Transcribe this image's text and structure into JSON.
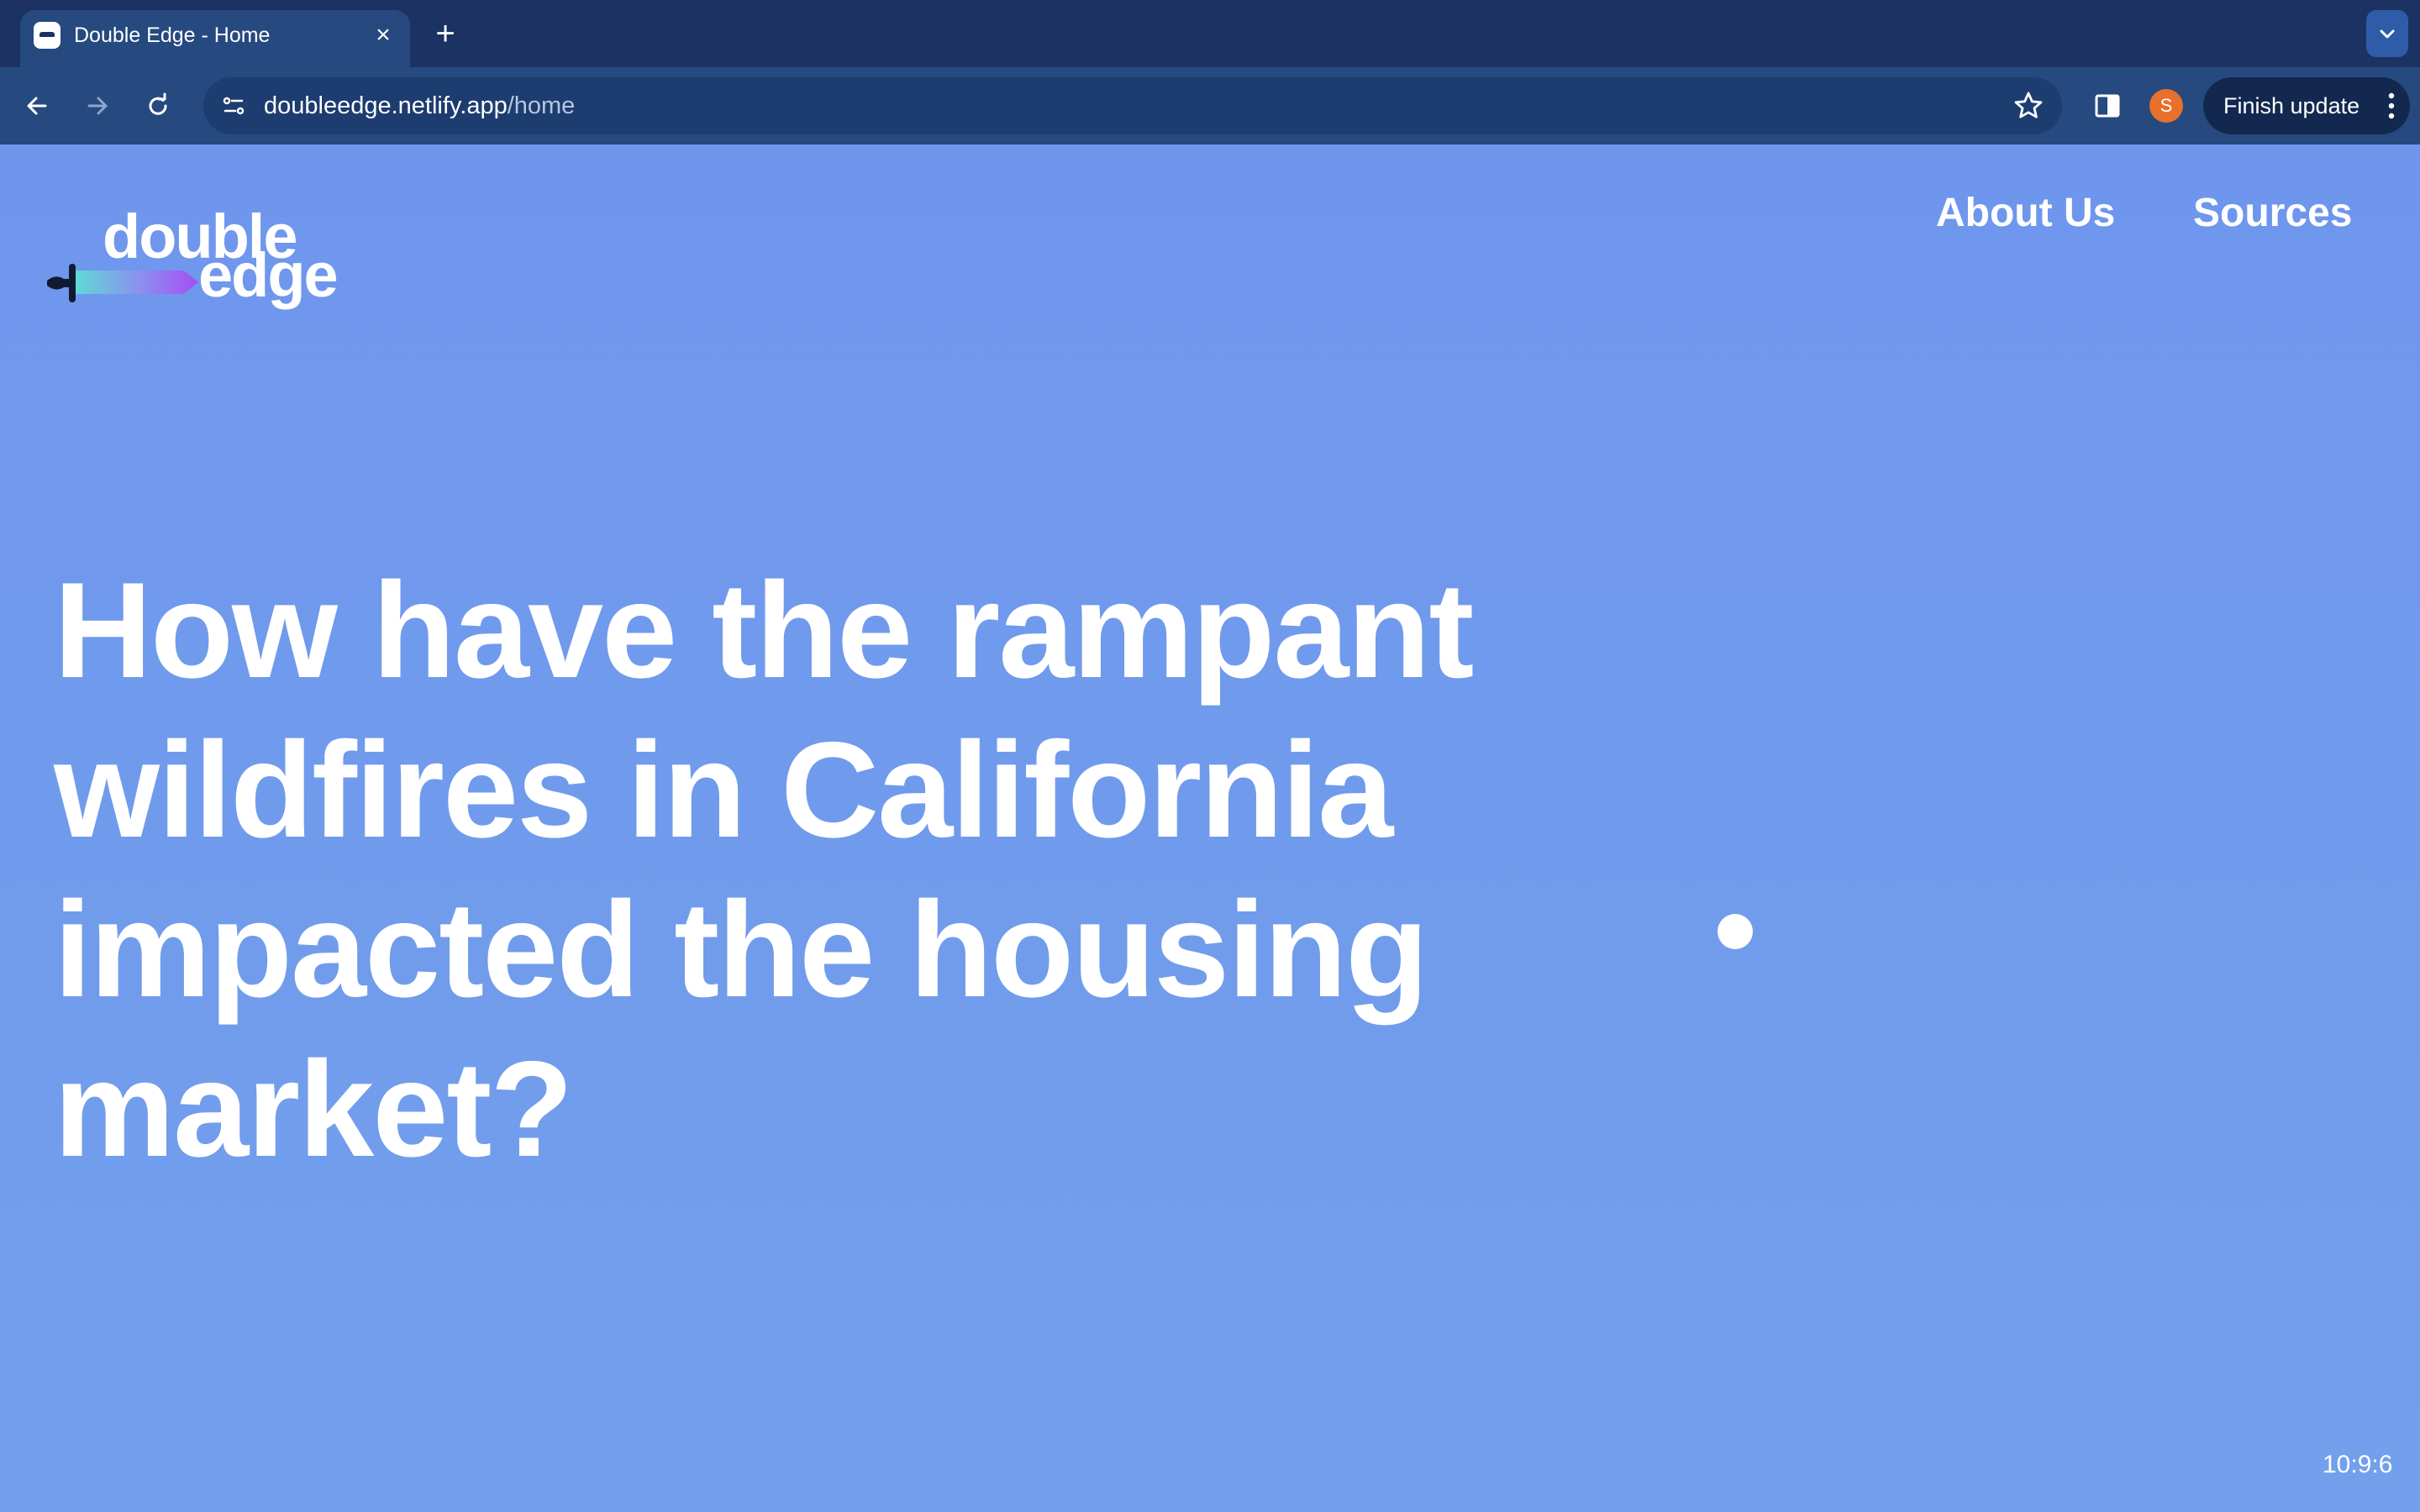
{
  "browser": {
    "tab": {
      "title": "Double Edge - Home",
      "favicon": "double-edge-favicon"
    },
    "url": {
      "domain": "doubleedge.netlify.app",
      "path": "/home"
    },
    "profile_initial": "S",
    "finish_update_label": "Finish update",
    "colors": {
      "tabstrip": "#1b3263",
      "toolbar": "#26497f",
      "profile": "#e8702a"
    }
  },
  "site": {
    "logo": {
      "line1": "double",
      "line2": "edge"
    },
    "nav": [
      {
        "label": "About Us"
      },
      {
        "label": "Sources"
      }
    ],
    "hero_title": "How have the rampant wildfires in California impacted the housing market?",
    "clock": "10:9:6",
    "colors": {
      "background": "#6f98ee",
      "text": "#ffffff"
    }
  }
}
